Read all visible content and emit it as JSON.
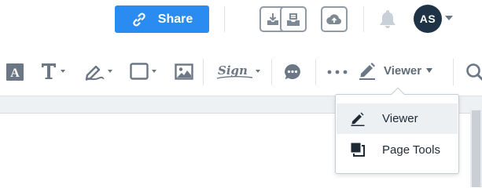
{
  "topbar": {
    "share_label": "Share",
    "avatar_initials": "AS",
    "icons": [
      "link-icon",
      "download-icon",
      "inbox-icon",
      "cloud-upload-icon",
      "bell-icon",
      "chevron-down-icon"
    ]
  },
  "toolbar": {
    "sign_label": "Sign",
    "viewer_label": "Viewer",
    "icons": [
      "text-box-icon",
      "text-icon",
      "pen-icon",
      "rectangle-icon",
      "image-icon",
      "signature-icon",
      "comment-icon",
      "more-icon",
      "search-icon"
    ]
  },
  "mode_menu": {
    "items": [
      {
        "label": "Viewer",
        "icon": "pencil-icon",
        "selected": true
      },
      {
        "label": "Page Tools",
        "icon": "pages-icon",
        "selected": false
      }
    ]
  },
  "colors": {
    "accent": "#2a8cf0",
    "avatar_bg": "#1f3346",
    "icon_gray": "#6b7784",
    "menu_hover": "#edf0f3"
  }
}
